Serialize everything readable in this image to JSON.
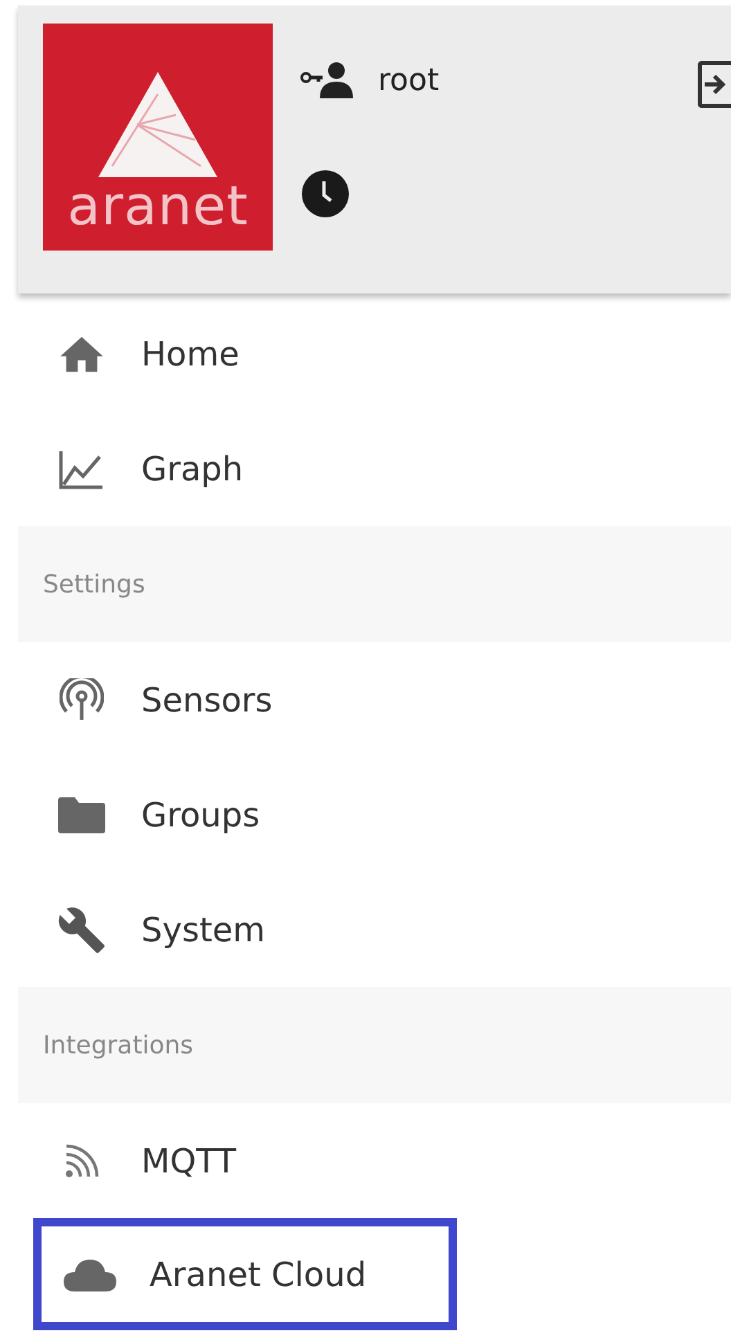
{
  "header": {
    "logo_text": "aranet",
    "user": "root"
  },
  "menu": [
    {
      "kind": "item",
      "label": "Home",
      "highlighted": false
    },
    {
      "kind": "item",
      "label": "Graph",
      "highlighted": false
    },
    {
      "kind": "section",
      "label": "Settings"
    },
    {
      "kind": "item",
      "label": "Sensors",
      "highlighted": false
    },
    {
      "kind": "item",
      "label": "Groups",
      "highlighted": false
    },
    {
      "kind": "item",
      "label": "System",
      "highlighted": false
    },
    {
      "kind": "section",
      "label": "Integrations"
    },
    {
      "kind": "item",
      "label": "MQTT",
      "highlighted": false
    },
    {
      "kind": "item",
      "label": "Aranet Cloud",
      "highlighted": true
    }
  ]
}
